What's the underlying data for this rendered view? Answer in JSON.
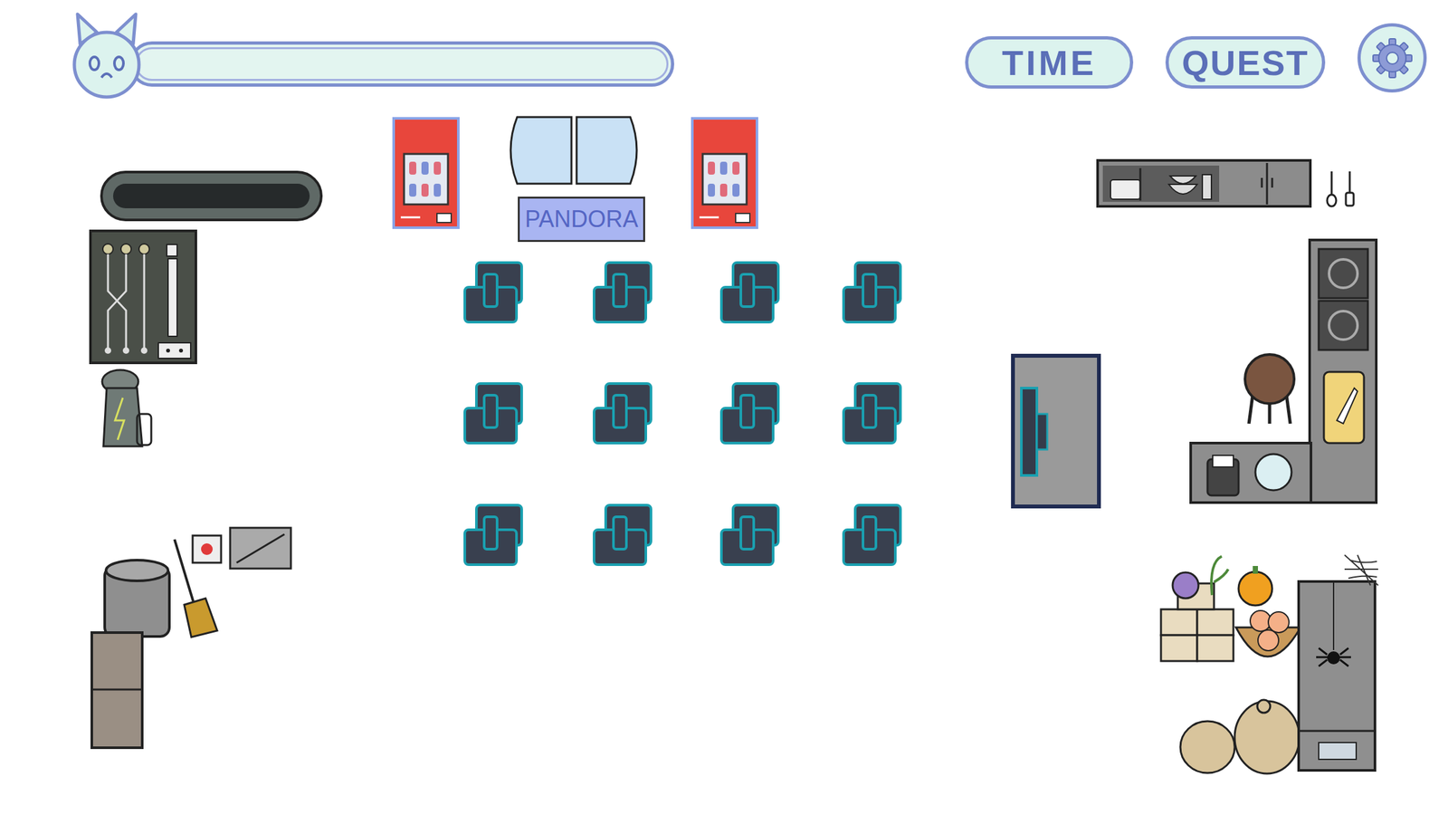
{
  "mood_bar": {
    "level": 0
  },
  "buttons": [
    {
      "label": "TIME"
    },
    {
      "label": "QUEST"
    }
  ],
  "sign": {
    "text": "PANDORA"
  }
}
